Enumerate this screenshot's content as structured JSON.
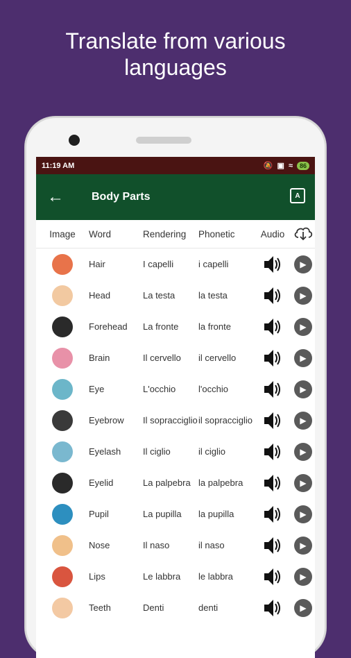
{
  "promo": {
    "line1": "Translate from various",
    "line2": "languages"
  },
  "status": {
    "time": "11:19 AM",
    "battery": "86"
  },
  "appbar": {
    "title": "Body Parts",
    "back_icon": "arrow-left-icon",
    "translate_icon": "translate-icon"
  },
  "columns": {
    "image": "Image",
    "word": "Word",
    "rendering": "Rendering",
    "phonetic": "Phonetic",
    "audio": "Audio",
    "download_icon": "cloud-download-icon"
  },
  "rows": [
    {
      "word": "Hair",
      "rendering": "I capelli",
      "phonetic": "i capelli",
      "img": "hair",
      "color": "#e8734a"
    },
    {
      "word": "Head",
      "rendering": "La testa",
      "phonetic": "la testa",
      "img": "head",
      "color": "#f2c9a1"
    },
    {
      "word": "Forehead",
      "rendering": "La fronte",
      "phonetic": "la fronte",
      "img": "forehead",
      "color": "#2a2a2a"
    },
    {
      "word": "Brain",
      "rendering": "Il cervello",
      "phonetic": "il cervello",
      "img": "brain",
      "color": "#e891a8"
    },
    {
      "word": "Eye",
      "rendering": "L'occhio",
      "phonetic": "l'occhio",
      "img": "eye",
      "color": "#6cb6c9"
    },
    {
      "word": "Eyebrow",
      "rendering": "Il sopracciglio",
      "phonetic": "il sopracciglio",
      "img": "eyebrow",
      "color": "#3a3a3a"
    },
    {
      "word": "Eyelash",
      "rendering": "Il ciglio",
      "phonetic": "il ciglio",
      "img": "eyelash",
      "color": "#7ab8cf"
    },
    {
      "word": "Eyelid",
      "rendering": "La palpebra",
      "phonetic": "la palpebra",
      "img": "eyelid",
      "color": "#2a2a2a"
    },
    {
      "word": "Pupil",
      "rendering": "La pupilla",
      "phonetic": "la pupilla",
      "img": "pupil",
      "color": "#2d8fbf"
    },
    {
      "word": "Nose",
      "rendering": "Il naso",
      "phonetic": "il naso",
      "img": "nose",
      "color": "#f0c08a"
    },
    {
      "word": "Lips",
      "rendering": "Le labbra",
      "phonetic": "le labbra",
      "img": "lips",
      "color": "#d9553f"
    },
    {
      "word": "Teeth",
      "rendering": "Denti",
      "phonetic": "denti",
      "img": "teeth",
      "color": "#f3c9a3"
    }
  ],
  "colors": {
    "background": "#4d2e6e",
    "statusbar": "#4a1412",
    "appbar": "#11502b"
  }
}
